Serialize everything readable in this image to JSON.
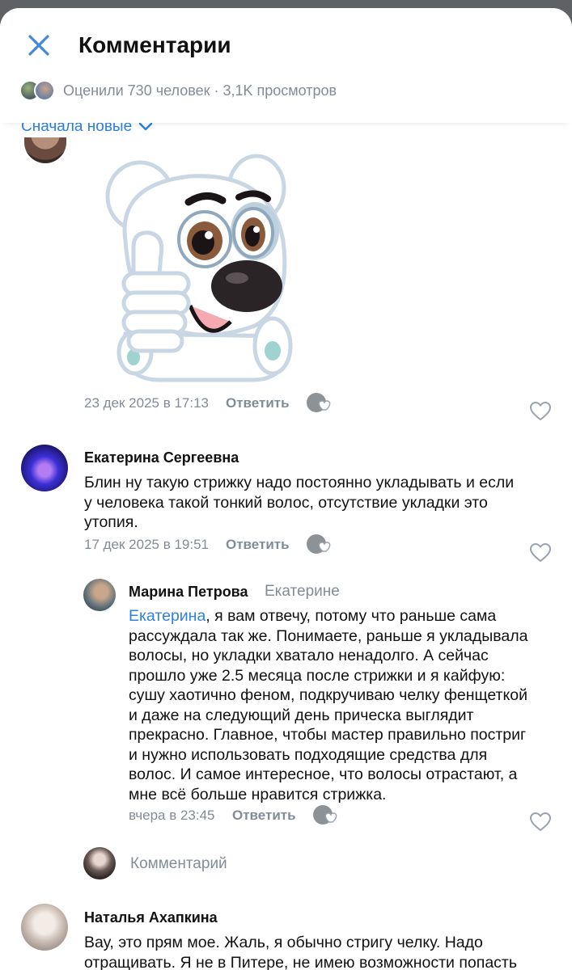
{
  "header": {
    "title": "Комментарии",
    "stats": "Оценили 730 человек · 3,1K просмотров",
    "sort_label": "Сначала новые"
  },
  "comments": [
    {
      "date": "23 дек 2025 в 17:13",
      "reply_label": "Ответить"
    },
    {
      "author": "Екатерина Сергеевна",
      "text_lines": [
        "Блин ну такую стрижку надо постоянно укладывать и если",
        "у человека такой тонкий волос, отсутствие укладки это",
        "утопия."
      ],
      "date": "17 дек 2025 в 19:51",
      "reply_label": "Ответить"
    },
    {
      "author": "Марина Петрова",
      "reply_to": "Екатерине",
      "mention": "Екатерина",
      "text_first_rest": ", я вам отвечу, потому что раньше сама",
      "text_lines": [
        "рассуждала так же. Понимаете, раньше я укладывала",
        "волосы, но укладки хватало ненадолго. А сейчас",
        "прошло уже 2.5 месяца после стрижки и я кайфую:",
        "сушу хаотично феном, подкручиваю челку фенщеткой",
        "и даже на следующий день прическа выглядит",
        "прекрасно. Главное, чтобы мастер правильно постриг",
        "и нужно использовать подходящие средства для",
        "волос. И самое интересное, что волосы отрастают, а",
        "мне всё больше нравится стрижка."
      ],
      "date": "вчера в 23:45",
      "reply_label": "Ответить"
    },
    {
      "author": "Наталья Ахапкина",
      "text_lines": [
        "Вау, это прям мое. Жаль, я обычно стригу челку. Надо",
        "отращивать. Я не в Питере, не имею возможности попасть"
      ]
    }
  ],
  "composer": {
    "placeholder": "Комментарий"
  },
  "icons": {
    "close": "close-icon",
    "chevron": "chevron-down-icon",
    "heart": "heart-outline-icon",
    "sticker": "thumbs-up-dog-sticker"
  },
  "colors": {
    "accent": "#2d81e0",
    "secondary_text": "#818c99",
    "icon_blue": "#3f8ae0"
  }
}
